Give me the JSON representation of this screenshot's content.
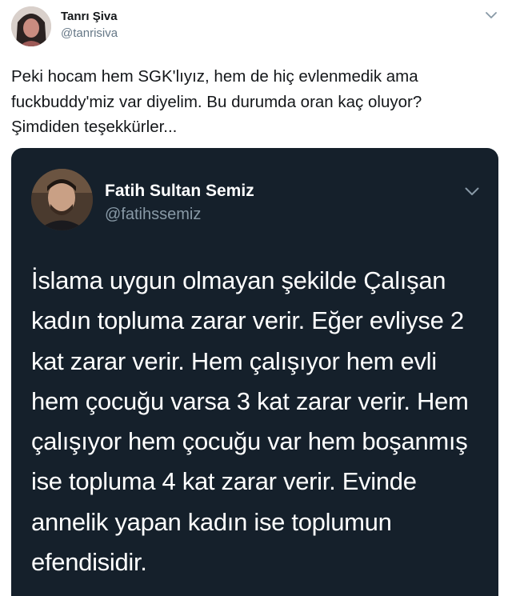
{
  "tweet": {
    "author": {
      "name": "Tanrı Şiva",
      "handle": "@tanrisiva"
    },
    "text_lines": [
      "Peki hocam hem SGK'lıyız, hem de hiç evlenmedik ama",
      "fuckbuddy'miz var diyelim. Bu durumda oran kaç oluyor?",
      "Şimdiden teşekkürler..."
    ]
  },
  "quoted_tweet": {
    "author": {
      "name": "Fatih Sultan Semiz",
      "handle": "@fatihssemiz"
    },
    "text_lines": [
      "İslama uygun olmayan şekilde Çalışan",
      "kadın topluma zarar verir. Eğer evliyse 2",
      "kat zarar verir. Hem çalışıyor hem evli",
      "hem çocuğu varsa 3 kat zarar verir. Hem",
      "çalışıyor hem çocuğu var hem boşanmış",
      "ise topluma 4 kat zarar verir. Evinde",
      "annelik yapan kadın ise toplumun",
      "efendisidir."
    ]
  },
  "icons": {
    "tweet_menu": "chevron-down-icon",
    "quoted_menu": "chevron-down-icon"
  },
  "colors": {
    "primary_text": "#14171a",
    "secondary_text": "#657786",
    "quote_background": "#15202b",
    "quote_secondary_text": "#8899a6"
  }
}
